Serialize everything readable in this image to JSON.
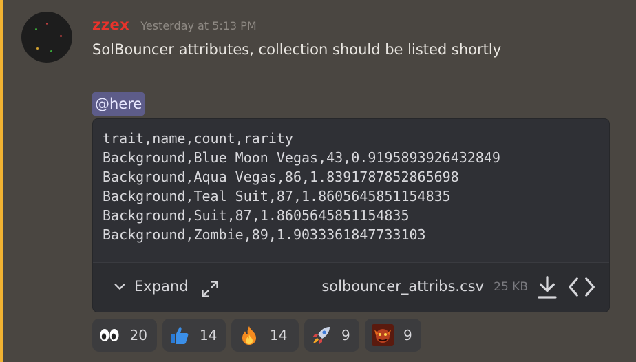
{
  "message": {
    "author": "zzex",
    "timestamp": "Yesterday at 5:13 PM",
    "text": "SolBouncer attributes, collection should be listed shortly",
    "mention": "@here",
    "colors": {
      "author": "#e8332b",
      "mention_bar": "#f0b232",
      "mention_bg": "#5d5c89"
    }
  },
  "attachment": {
    "lines": [
      "trait,name,count,rarity",
      "Background,Blue Moon Vegas,43,0.9195893926432849",
      "Background,Aqua Vegas,86,1.8391787852865698",
      "Background,Teal Suit,87,1.8605645851154835",
      "Background,Suit,87,1.8605645851154835",
      "Background,Zombie,89,1.9033361847733103"
    ],
    "expand_label": "Expand",
    "filename": "solbouncer_attribs.csv",
    "filesize": "25 KB",
    "icons": [
      "chevron-down-icon",
      "fullscreen-icon",
      "download-icon",
      "code-icon"
    ]
  },
  "reactions": [
    {
      "icon": "eyes-emoji-icon",
      "count": "20"
    },
    {
      "icon": "thumbs-up-emoji-icon",
      "count": "14"
    },
    {
      "icon": "fire-emoji-icon",
      "count": "14"
    },
    {
      "icon": "rocket-emoji-icon",
      "count": "9"
    },
    {
      "icon": "custom-emoji-icon",
      "count": "9"
    }
  ]
}
